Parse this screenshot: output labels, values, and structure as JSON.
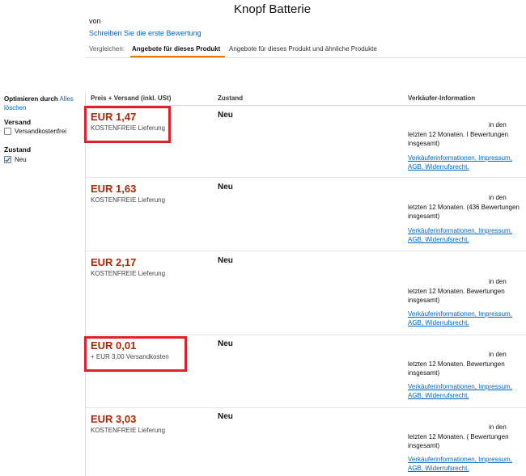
{
  "header": {
    "title": "Knopf Batterie",
    "by_label": "von",
    "first_review_link": "Schreiben Sie die erste Bewertung"
  },
  "compare": {
    "label": "Vergleichen:",
    "tabs": [
      {
        "label": "Angebote für dieses Produkt",
        "active": true
      },
      {
        "label": "Angebote für dieses Produkt und ähnliche Produkte",
        "active": false
      }
    ]
  },
  "sidebar": {
    "optimize_label": "Optimieren durch",
    "clear_link": "Alles löschen",
    "shipping": {
      "heading": "Versand",
      "option": "Versandkostenfrei",
      "checked": false
    },
    "condition": {
      "heading": "Zustand",
      "option": "Neu",
      "checked": true
    }
  },
  "table": {
    "headers": [
      "Preis + Versand (inkl. USt)",
      "Zustand",
      "Verkäufer-Information"
    ],
    "offers": [
      {
        "price": "EUR 1,47",
        "shipping": "KOSTENFREIE Lieferung",
        "condition": "Neu",
        "seller_a": "in den",
        "seller_b": "letzten 12 Monaten. I Bewertungen insgesamt)",
        "seller_link": "Verkäuferinformationen, Impressum, AGB, Widerrufsrecht.",
        "highlighted": true
      },
      {
        "price": "EUR 1,63",
        "shipping": "KOSTENFREIE Lieferung",
        "condition": "Neu",
        "seller_a": "in den",
        "seller_b": "letzten 12 Monaten. (436 Bewertungen insgesamt)",
        "seller_link": "Verkäuferinformationen, Impressum, AGB, Widerrufsrecht.",
        "highlighted": false
      },
      {
        "price": "EUR 2,17",
        "shipping": "KOSTENFREIE Lieferung",
        "condition": "Neu",
        "seller_a": "in den",
        "seller_b": "letzten 12 Monaten. Bewertungen insgesamt)",
        "seller_link": "Verkäuferinformationen, Impressum, AGB, Widerrufsrecht.",
        "highlighted": false
      },
      {
        "price": "EUR 0,01",
        "shipping": "+ EUR 3,00 Versandkosten",
        "condition": "Neu",
        "seller_a": "in den",
        "seller_b": "letzten 12 Monaten. Bewertungen insgesamt)",
        "seller_link": "Verkäuferinformationen, Impressum, AGB, Widerrufsrecht.",
        "highlighted": true
      },
      {
        "price": "EUR 3,03",
        "shipping": "KOSTENFREIE Lieferung",
        "condition": "Neu",
        "seller_a": "in den",
        "seller_b": "letzten 12 Monaten. ( Bewertungen insgesamt)",
        "seller_link": "Verkäuferinformationen, Impressum, AGB, Widerrufsrecht.",
        "highlighted": false
      }
    ]
  },
  "colors": {
    "price": "#b12704",
    "link": "#0066c0",
    "active_tab_underline": "#e77600",
    "highlight_box": "#e0202a"
  }
}
